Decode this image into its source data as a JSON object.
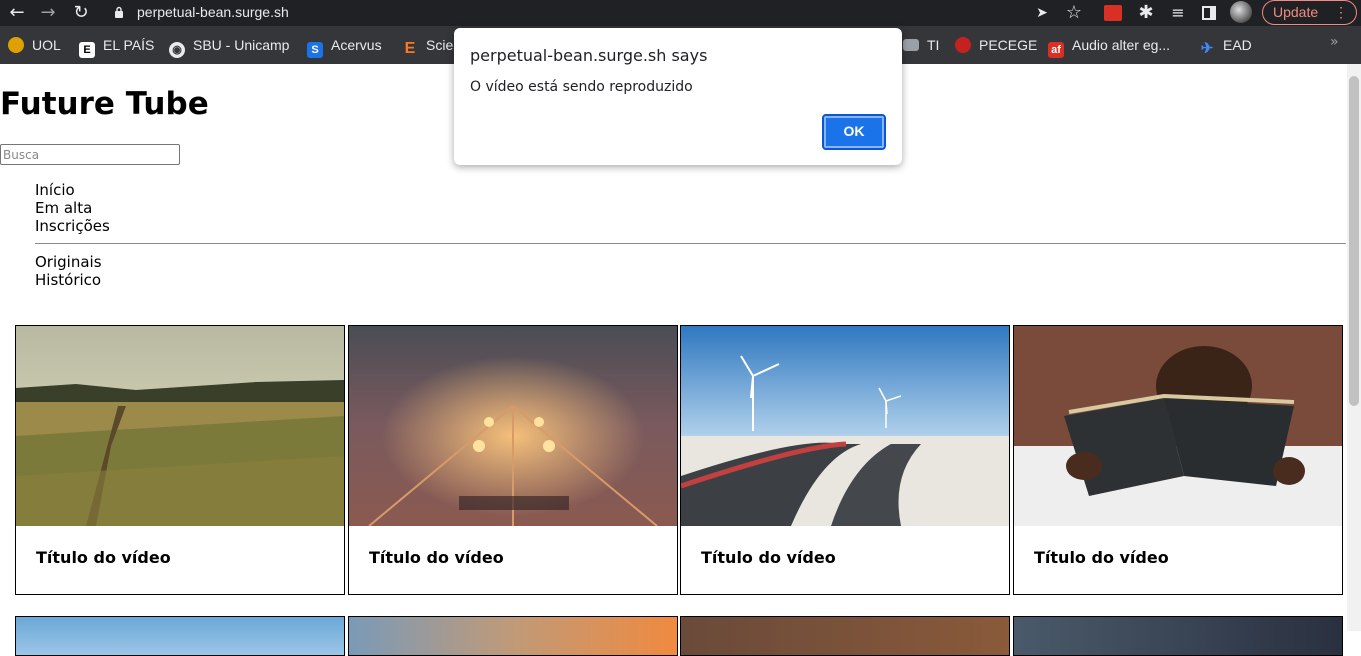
{
  "browser": {
    "url": "perpetual-bean.surge.sh",
    "update_label": "Update",
    "update_dots": "⋮",
    "bookmarks": [
      {
        "label": "UOL",
        "icon": "uol-icon",
        "color": "#e0a100"
      },
      {
        "label": "EL PAÍS",
        "icon": "elpais-icon",
        "color": "#ffffff"
      },
      {
        "label": "SBU - Unicamp",
        "icon": "globe-icon",
        "color": "#e8eaed"
      },
      {
        "label": "Acervus",
        "icon": "acervus-icon",
        "color": "#1a73e8"
      },
      {
        "label": "Scie",
        "icon": "elsevier-icon",
        "color": "#f47b20"
      },
      {
        "label": "TI",
        "icon": "folder-icon",
        "color": "#9aa0a6"
      },
      {
        "label": "PECEGE",
        "icon": "pecege-icon",
        "color": "#c5221f"
      },
      {
        "label": "Audio alter eg...",
        "icon": "audio-icon",
        "color": "#d93025"
      },
      {
        "label": "EAD",
        "icon": "ead-icon",
        "color": "#4285f4"
      }
    ],
    "more": "»"
  },
  "page": {
    "title": "Future Tube",
    "search_placeholder": "Busca",
    "nav_primary": [
      "Início",
      "Em alta",
      "Inscrições"
    ],
    "nav_secondary": [
      "Originais",
      "Histórico"
    ],
    "videos": [
      {
        "title": "Título do vídeo",
        "thumb": "field-path"
      },
      {
        "title": "Título do vídeo",
        "thumb": "foggy-railway"
      },
      {
        "title": "Título do vídeo",
        "thumb": "wind-turbines-road"
      },
      {
        "title": "Título do vídeo",
        "thumb": "child-reading-bible"
      }
    ]
  },
  "dialog": {
    "title": "perpetual-bean.surge.sh says",
    "message": "O vídeo está sendo reproduzido",
    "ok_label": "OK"
  }
}
